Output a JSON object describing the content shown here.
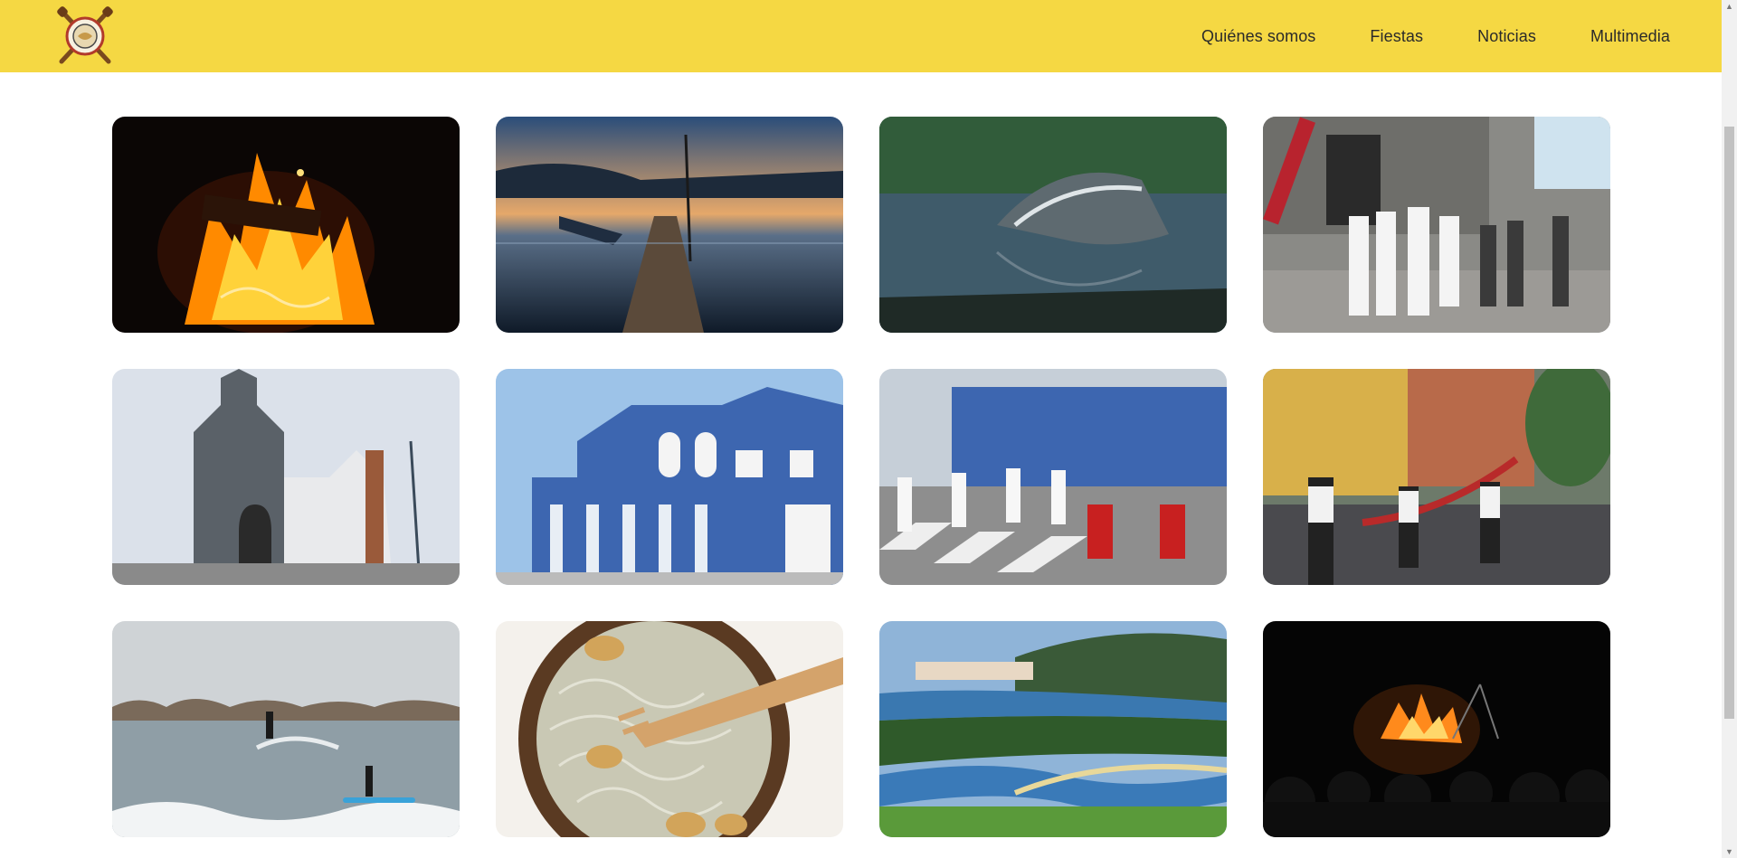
{
  "header": {
    "logo_icon": "crossed-oars-anchor-logo",
    "background": "#f5d843",
    "nav": [
      {
        "label": "Quiénes somos"
      },
      {
        "label": "Fiestas"
      },
      {
        "label": "Noticias"
      },
      {
        "label": "Multimedia"
      }
    ]
  },
  "gallery": {
    "items": [
      {
        "subject": "bonfire-boat-night"
      },
      {
        "subject": "pier-sunset-boats"
      },
      {
        "subject": "shipwreck-river"
      },
      {
        "subject": "procession-sailors"
      },
      {
        "subject": "stone-church"
      },
      {
        "subject": "blue-white-building"
      },
      {
        "subject": "procession-blue-building"
      },
      {
        "subject": "traditional-dancers-street"
      },
      {
        "subject": "surfers-waves"
      },
      {
        "subject": "elvers-dish-fork"
      },
      {
        "subject": "estuary-landscape"
      },
      {
        "subject": "bonfire-crowd-night"
      }
    ]
  }
}
